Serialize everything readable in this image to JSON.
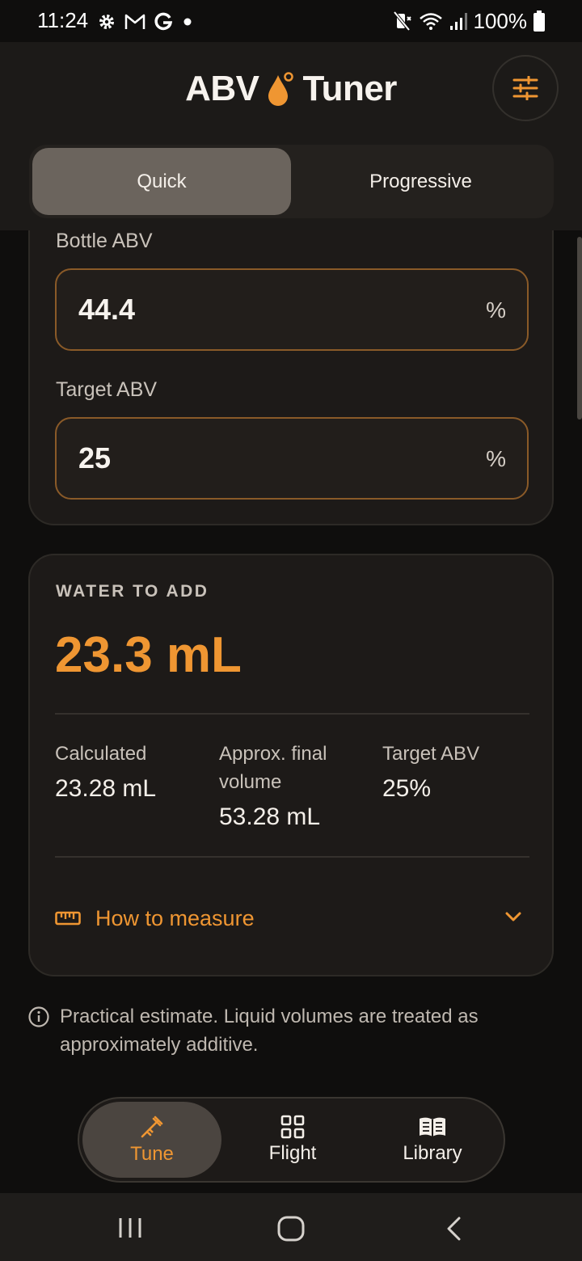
{
  "status_bar": {
    "time": "11:24",
    "left_icons": [
      "gear-icon",
      "gmail-icon",
      "google-icon",
      "dot-icon"
    ],
    "battery_text": "100%",
    "right_icons": [
      "mute-icon",
      "wifi-icon",
      "signal-icon",
      "battery-icon"
    ]
  },
  "header": {
    "title_left": "ABV",
    "title_right": "Tuner",
    "logo_icon": "drop-icon",
    "settings_icon": "sliders-icon"
  },
  "mode_tabs": {
    "quick": "Quick",
    "progressive": "Progressive",
    "selected": "Quick"
  },
  "inputs": {
    "bottle_abv": {
      "label": "Bottle ABV",
      "value": "44.4",
      "unit": "%"
    },
    "target_abv": {
      "label": "Target ABV",
      "value": "25",
      "unit": "%"
    }
  },
  "result": {
    "label": "WATER TO ADD",
    "value": "23.3 mL",
    "stats": [
      {
        "label": "Calculated",
        "value": "23.28 mL"
      },
      {
        "label": "Approx. final volume",
        "value": "53.28 mL"
      },
      {
        "label": "Target ABV",
        "value": "25%"
      }
    ],
    "measure": {
      "label": "How to measure",
      "icon": "ruler-icon",
      "chevron": "chevron-down-icon"
    }
  },
  "note": {
    "icon": "info-icon",
    "text": "Practical estimate. Liquid volumes are treated as approximately additive."
  },
  "bottom_nav": {
    "items": [
      {
        "label": "Tune",
        "icon": "pipette-icon",
        "active": true
      },
      {
        "label": "Flight",
        "icon": "grid-icon",
        "active": false
      },
      {
        "label": "Library",
        "icon": "book-icon",
        "active": false
      }
    ]
  },
  "colors": {
    "accent": "#ef9632",
    "background": "#0f0e0d",
    "card": "#1d1a18",
    "input_border": "#8a5a28"
  }
}
